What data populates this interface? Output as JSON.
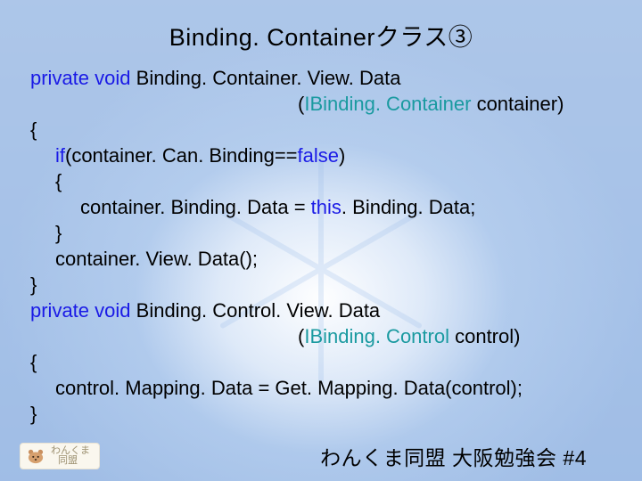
{
  "title": "Binding. Containerクラス③",
  "code": {
    "l1a": "private",
    "l1b": " ",
    "l1c": "void",
    "l1d": " Binding. Container. View. Data",
    "l2a": "(",
    "l2b": "IBinding. Container",
    "l2c": " container)",
    "l3": "{",
    "l4a": "if",
    "l4b": "(container. Can. Binding==",
    "l4c": "false",
    "l4d": ")",
    "l5": "{",
    "l6a": "container. Binding. Data = ",
    "l6b": "this",
    "l6c": ". Binding. Data;",
    "l7": "}",
    "l8": "container. View. Data();",
    "l9": "}",
    "l10a": "private",
    "l10b": " ",
    "l10c": "void",
    "l10d": " Binding. Control. View. Data",
    "l11a": "(",
    "l11b": "IBinding. Control",
    "l11c": " control)",
    "l12": "{",
    "l13": "control. Mapping. Data = Get. Mapping. Data(control);",
    "l14": "}"
  },
  "logo": {
    "line1": "わんくま",
    "line2": "同盟"
  },
  "footer": "わんくま同盟 大阪勉強会 #4"
}
